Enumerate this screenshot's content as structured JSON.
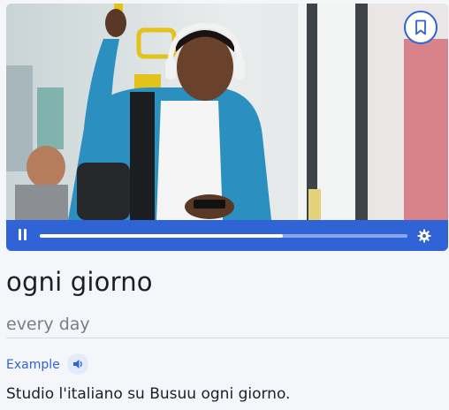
{
  "lesson": {
    "word": "ogni giorno",
    "translation": "every day",
    "example_label": "Example",
    "example_sentence": "Studio l'italiano su Busuu ogni giorno."
  },
  "player": {
    "progress": 0.66
  },
  "icons": {
    "bookmark": "bookmark-icon",
    "pause": "pause-icon",
    "settings": "gear-icon",
    "audio": "speaker-icon"
  },
  "colors": {
    "accent": "#2f63d6",
    "background": "#f4f6fa",
    "text": "#1b1f2a",
    "muted": "#7a7e88"
  }
}
